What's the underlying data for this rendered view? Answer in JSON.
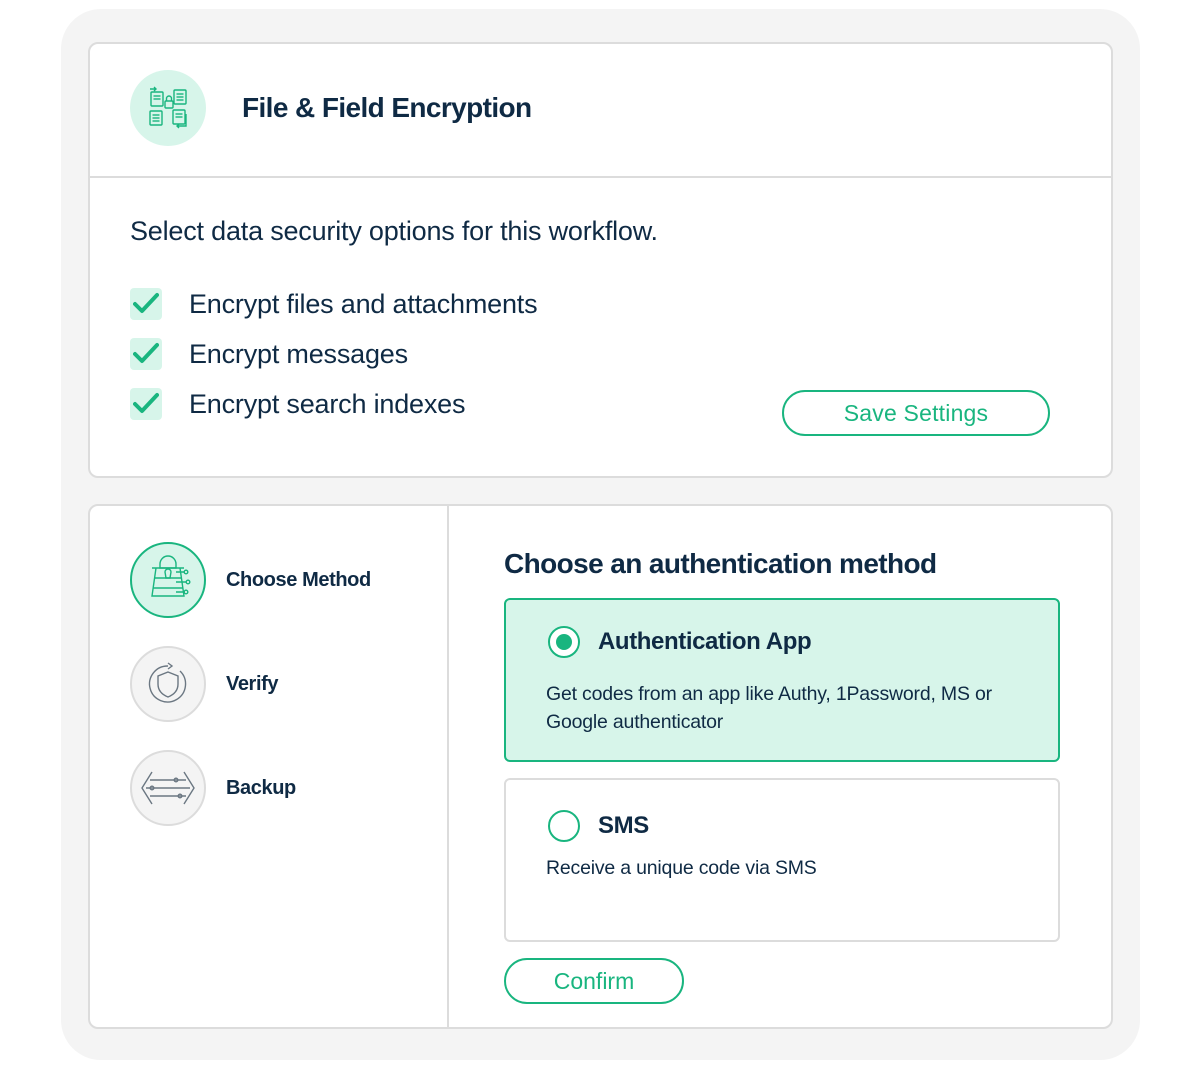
{
  "encryption": {
    "title": "File & Field Encryption",
    "icon": "file-encryption-icon",
    "subtitle": "Select data security options for this workflow.",
    "options": [
      {
        "label": "Encrypt files and attachments",
        "checked": true
      },
      {
        "label": "Encrypt messages",
        "checked": true
      },
      {
        "label": "Encrypt search indexes",
        "checked": true
      }
    ],
    "save_label": "Save Settings"
  },
  "steps": [
    {
      "label": "Choose Method",
      "icon": "keyhole-circuit-icon",
      "active": true
    },
    {
      "label": "Verify",
      "icon": "shield-refresh-icon",
      "active": false
    },
    {
      "label": "Backup",
      "icon": "data-lines-icon",
      "active": false
    }
  ],
  "auth": {
    "title": "Choose an authentication method",
    "methods": [
      {
        "title": "Authentication App",
        "description": "Get codes from an app like Authy, 1Password, MS or Google authenticator",
        "selected": true
      },
      {
        "title": "SMS",
        "description": "Receive a unique code via SMS",
        "selected": false
      }
    ],
    "confirm_label": "Confirm"
  },
  "colors": {
    "accent": "#19b57f",
    "accent_light": "#d7f5ea",
    "text": "#0f2a44",
    "border": "#dcdcdc",
    "background": "#f4f4f4"
  }
}
